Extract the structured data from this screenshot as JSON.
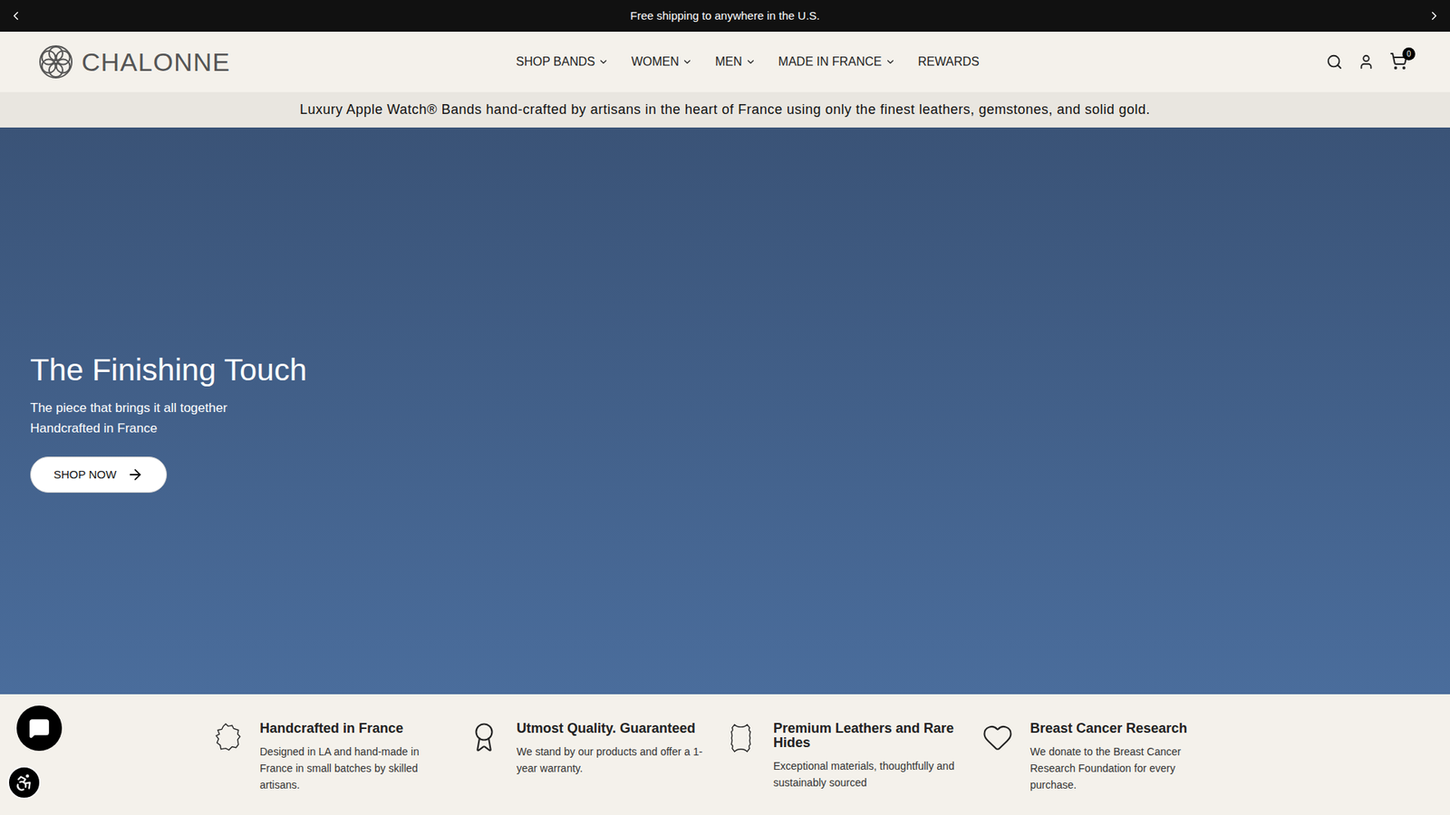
{
  "announcement": {
    "text": "Free shipping to anywhere in the U.S."
  },
  "brand": {
    "name": "CHALONNE"
  },
  "nav": [
    {
      "label": "SHOP BANDS",
      "dropdown": true
    },
    {
      "label": "WOMEN",
      "dropdown": true
    },
    {
      "label": "MEN",
      "dropdown": true
    },
    {
      "label": "MADE IN FRANCE",
      "dropdown": true
    },
    {
      "label": "REWARDS",
      "dropdown": false
    }
  ],
  "cart": {
    "count": "0"
  },
  "tagline": "Luxury Apple Watch® Bands hand-crafted by artisans in the heart of France using only the finest leathers, gemstones, and solid gold.",
  "hero": {
    "title": "The Finishing Touch",
    "subtitle": [
      "The piece that brings it all together",
      "Handcrafted in France"
    ],
    "button": "SHOP NOW"
  },
  "features": [
    {
      "kind": "france",
      "title": "Handcrafted in France",
      "text": "Designed in LA and hand-made in France in small batches by skilled artisans."
    },
    {
      "kind": "award",
      "title": "Utmost Quality. Guaranteed",
      "text": "We stand by our products and offer a 1-year warranty."
    },
    {
      "kind": "hide",
      "title": "Premium Leathers and Rare Hides",
      "text": "Exceptional materials, thoughtfully and sustainably sourced"
    },
    {
      "kind": "heart",
      "title": "Breast Cancer Research",
      "text": "We donate to the Breast Cancer Research Foundation for every purchase."
    }
  ]
}
